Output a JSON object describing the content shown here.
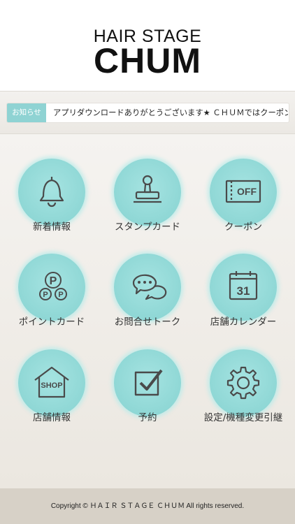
{
  "header": {
    "logo_line1": "HAIR STAGE",
    "logo_line2": "CHUM"
  },
  "news": {
    "badge": "お知らせ",
    "text": "アプリダウンロードありがとうございます★ ＣＨＵＭではクーポンやスタ"
  },
  "menu": {
    "items": [
      {
        "label": "新着情報",
        "icon": "bell-icon"
      },
      {
        "label": "スタンプカード",
        "icon": "stamp-icon"
      },
      {
        "label": "クーポン",
        "icon": "coupon-icon",
        "icon_text": "OFF"
      },
      {
        "label": "ポイントカード",
        "icon": "points-icon",
        "icon_text": "P"
      },
      {
        "label": "お問合せトーク",
        "icon": "chat-bubbles-icon"
      },
      {
        "label": "店舗カレンダー",
        "icon": "calendar-icon",
        "icon_text": "31"
      },
      {
        "label": "店舗情報",
        "icon": "shop-icon",
        "icon_text": "SHOP"
      },
      {
        "label": "予約",
        "icon": "checkbox-icon"
      },
      {
        "label": "設定/機種変更引継",
        "icon": "gear-icon"
      }
    ]
  },
  "footer": {
    "copyright": "Copyright © ＨＡＩＲ ＳＴＡＧＥ ＣＨＵＭ All rights reserved."
  },
  "colors": {
    "accent": "#92d9d7",
    "badge": "#8fd3d3",
    "footer_bg": "#d7d1c7",
    "icon_stroke": "#4a4a4a"
  }
}
